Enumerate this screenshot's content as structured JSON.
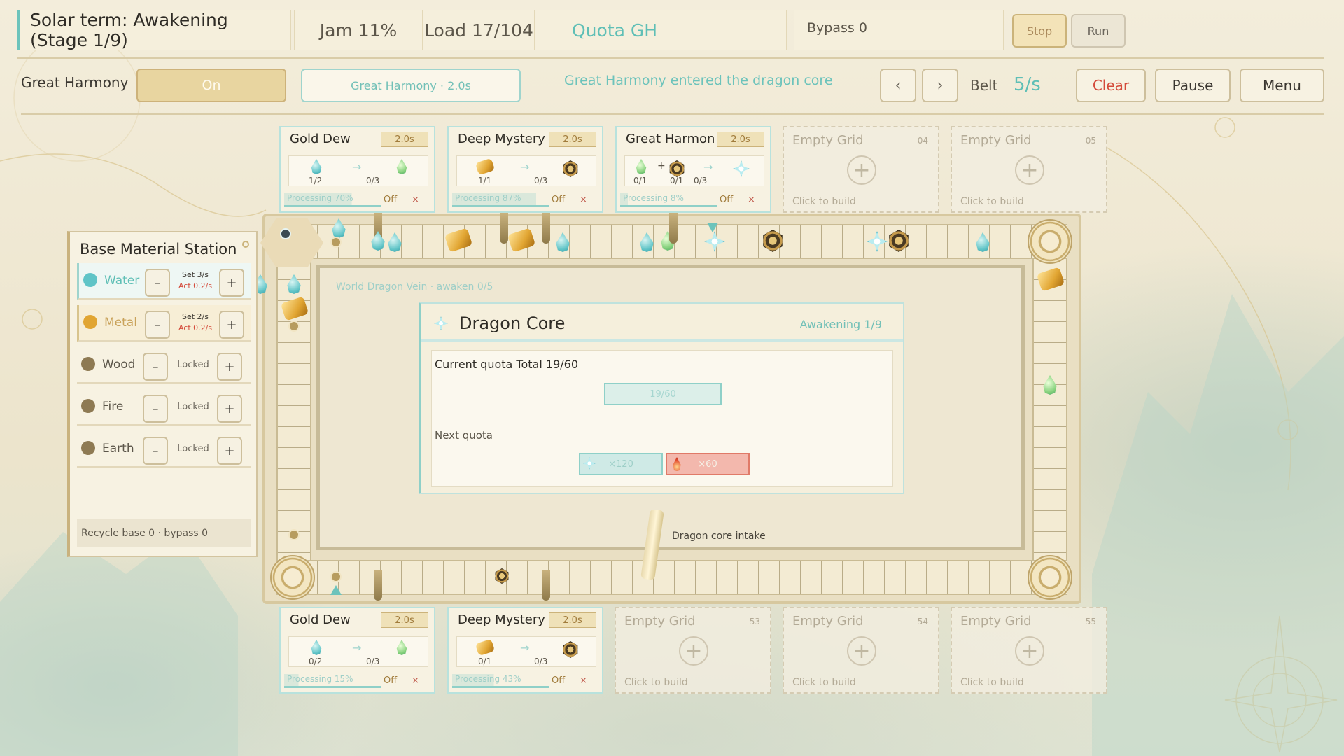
{
  "hud": {
    "title": "Solar term: Awakening (Stage 1/9)",
    "jam": "Jam 11%",
    "load": "Load 17/104",
    "quota": "Quota GH",
    "bypass": "Bypass 0",
    "stop_label": "Stop",
    "run_label": "Run"
  },
  "controls": {
    "recipe_label": "Great Harmony",
    "toggle_label": "On",
    "recipe_button": "Great Harmony · 2.0s",
    "status_message": "Great Harmony entered the dragon core",
    "prev_label": "‹",
    "next_label": "›",
    "belt_label": "Belt",
    "belt_speed": "5/s",
    "clear_label": "Clear",
    "pause_label": "Pause",
    "menu_label": "Menu"
  },
  "top_cards": [
    {
      "name": "Gold Dew",
      "time": "2.0s",
      "in": "1/2",
      "out": "0/3",
      "progress": "Processing 70%",
      "progress_value": 0.7,
      "off": "Off",
      "remove": "×"
    },
    {
      "name": "Deep Mystery",
      "time": "2.0s",
      "in": "1/1",
      "out": "0/3",
      "progress": "Processing 87%",
      "progress_value": 0.87,
      "off": "Off",
      "remove": "×"
    },
    {
      "name": "Great Harmon",
      "time": "2.0s",
      "in1": "0/1",
      "in2": "0/1",
      "out": "0/3",
      "progress": "Processing 8%",
      "progress_value": 0.08,
      "off": "Off",
      "remove": "×",
      "plus": "+"
    }
  ],
  "top_empty": [
    {
      "name": "Empty Grid",
      "num": "04",
      "hint": "Click to build"
    },
    {
      "name": "Empty Grid",
      "num": "05",
      "hint": "Click to build"
    }
  ],
  "bottom_cards": [
    {
      "name": "Gold Dew",
      "time": "2.0s",
      "in": "0/2",
      "out": "0/3",
      "progress": "Processing 15%",
      "progress_value": 0.15,
      "off": "Off",
      "remove": "×"
    },
    {
      "name": "Deep Mystery",
      "time": "2.0s",
      "in": "0/1",
      "out": "0/3",
      "progress": "Processing 43%",
      "progress_value": 0.43,
      "off": "Off",
      "remove": "×"
    }
  ],
  "bottom_empty": [
    {
      "name": "Empty Grid",
      "num": "53",
      "hint": "Click to build"
    },
    {
      "name": "Empty Grid",
      "num": "54",
      "hint": "Click to build"
    },
    {
      "name": "Empty Grid",
      "num": "55",
      "hint": "Click to build"
    }
  ],
  "station": {
    "title": "Base Material Station",
    "materials": [
      {
        "name": "Water",
        "set": "Set 3/s",
        "act": "Act 0.2/s",
        "color": "#5fc4c7"
      },
      {
        "name": "Metal",
        "set": "Set 2/s",
        "act": "Act 0.2/s",
        "color": "#e1a532"
      },
      {
        "name": "Wood",
        "locked": "Locked"
      },
      {
        "name": "Fire",
        "locked": "Locked"
      },
      {
        "name": "Earth",
        "locked": "Locked"
      }
    ],
    "minus": "–",
    "plus": "+",
    "footer": "Recycle base 0 · bypass 0"
  },
  "field": {
    "vein": "World Dragon Vein · awaken 0/5",
    "intake": "Dragon core intake"
  },
  "core": {
    "title": "Dragon Core",
    "stage": "Awakening 1/9",
    "current_quota": "Current quota  Total 19/60",
    "bar_text": "19/60",
    "next_quota": "Next quota",
    "req1": "×120",
    "req2": "×60"
  },
  "colors": {
    "accent_teal": "#6cc3bb",
    "gold": "#c9b27e",
    "danger": "#d44a3a"
  }
}
